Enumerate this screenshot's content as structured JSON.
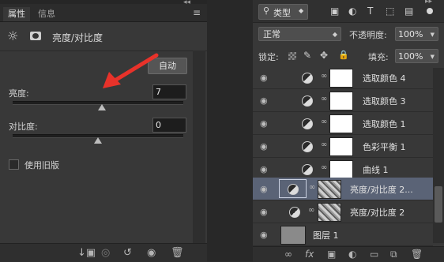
{
  "properties_panel": {
    "tabs": [
      "属性",
      "信息"
    ],
    "collapse_glyph": "◂◂",
    "menu_glyph": "≡",
    "title": "亮度/对比度",
    "auto_label": "自动",
    "brightness_label": "亮度:",
    "brightness_value": "7",
    "contrast_label": "对比度:",
    "contrast_value": "0",
    "legacy_label": "使用旧版"
  },
  "layers_panel": {
    "collapse_glyph": "▸▸",
    "filter_label": "类型",
    "blend_mode": "正常",
    "opacity_label": "不透明度:",
    "opacity_value": "100%",
    "lock_label": "锁定:",
    "fill_label": "填充:",
    "fill_value": "100%",
    "layers": [
      {
        "name": "选取颜色 4"
      },
      {
        "name": "选取颜色 3"
      },
      {
        "name": "选取颜色 1"
      },
      {
        "name": "色彩平衡 1"
      },
      {
        "name": "曲线 1"
      },
      {
        "name": "亮度/对比度 2..."
      },
      {
        "name": "亮度/对比度 2"
      },
      {
        "name": "图层 1"
      }
    ]
  },
  "colors": {
    "annotation_arrow": "#e8322a",
    "selected_layer": "#5a6376"
  }
}
